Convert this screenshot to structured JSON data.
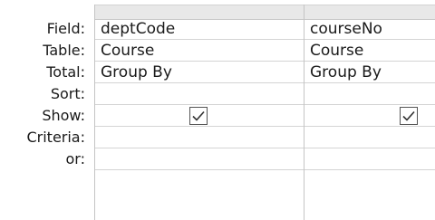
{
  "row_labels": [
    "Field:",
    "Table:",
    "Total:",
    "Sort:",
    "Show:",
    "Criteria:",
    "or:"
  ],
  "columns": [
    {
      "field": "deptCode",
      "table": "Course",
      "total": "Group By",
      "sort": "",
      "show": true,
      "criteria": "",
      "or": ""
    },
    {
      "field": "courseNo",
      "table": "Course",
      "total": "Group By",
      "sort": "",
      "show": true,
      "criteria": "",
      "or": ""
    }
  ],
  "colors": {
    "grid_line": "#d4d4d4",
    "header_bg": "#e8e8e8",
    "text": "#1a1a1a"
  },
  "icons": {
    "show_checkbox": "checkmark-icon"
  }
}
